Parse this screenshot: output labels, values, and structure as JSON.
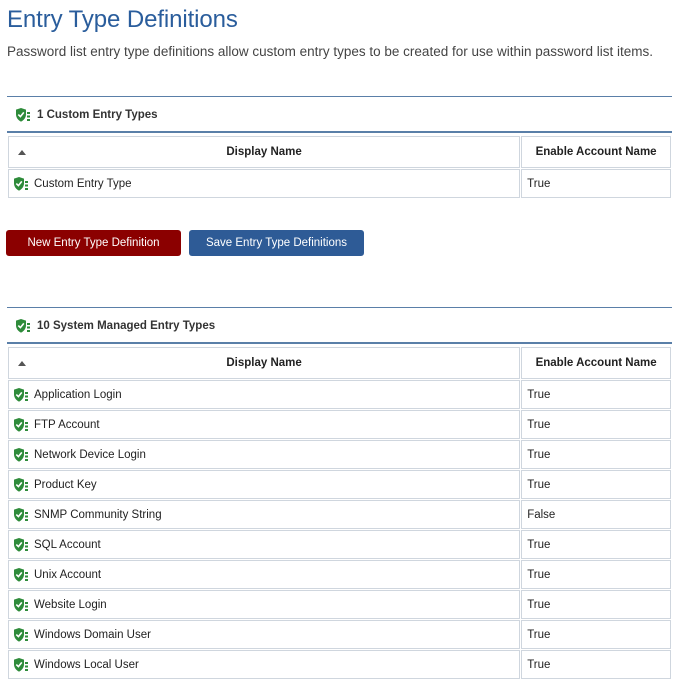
{
  "page": {
    "title": "Entry Type Definitions",
    "description": "Password list entry type definitions allow custom entry types to be created for use within password list items."
  },
  "custom_section": {
    "header": "1 Custom Entry Types",
    "columns": [
      "Display Name",
      "Enable Account Name"
    ],
    "rows": [
      {
        "name": "Custom Entry Type",
        "enable_account_name": "True"
      }
    ]
  },
  "buttons": {
    "new_label": "New Entry Type Definition",
    "save_label": "Save Entry Type Definitions"
  },
  "system_section": {
    "header": "10 System Managed Entry Types",
    "columns": [
      "Display Name",
      "Enable Account Name"
    ],
    "rows": [
      {
        "name": "Application Login",
        "enable_account_name": "True"
      },
      {
        "name": "FTP Account",
        "enable_account_name": "True"
      },
      {
        "name": "Network Device Login",
        "enable_account_name": "True"
      },
      {
        "name": "Product Key",
        "enable_account_name": "True"
      },
      {
        "name": "SNMP Community String",
        "enable_account_name": "False"
      },
      {
        "name": "SQL Account",
        "enable_account_name": "True"
      },
      {
        "name": "Unix Account",
        "enable_account_name": "True"
      },
      {
        "name": "Website Login",
        "enable_account_name": "True"
      },
      {
        "name": "Windows Domain User",
        "enable_account_name": "True"
      },
      {
        "name": "Windows Local User",
        "enable_account_name": "True"
      }
    ]
  },
  "icons": {
    "section": "shield-check-icon",
    "row": "shield-check-icon",
    "sort": "sort-asc-icon"
  },
  "colors": {
    "title": "#2a5d9c",
    "shield": "#2e8b3a",
    "new_button": "#8b0000",
    "save_button": "#2e5b96"
  }
}
